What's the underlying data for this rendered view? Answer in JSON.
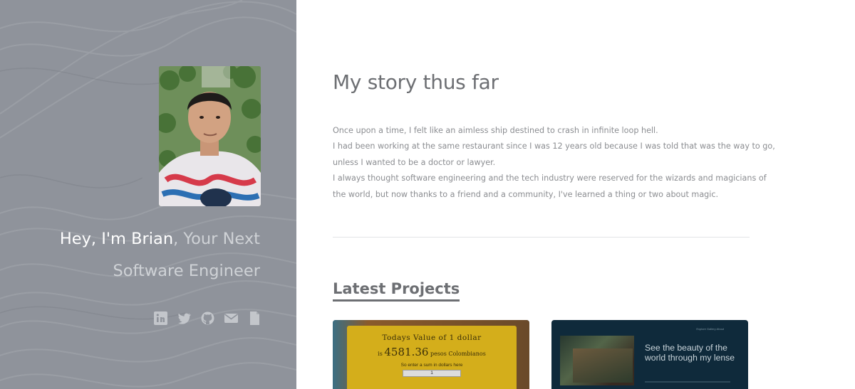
{
  "profile": {
    "greeting": "Hey, I'm Brian",
    "tagline_part1": ", Your Next",
    "tagline_part2": "Software Engineer",
    "photo_alt": "Portrait of Brian"
  },
  "socials": [
    {
      "icon": "linkedin-icon"
    },
    {
      "icon": "twitter-icon"
    },
    {
      "icon": "github-icon"
    },
    {
      "icon": "email-icon"
    },
    {
      "icon": "resume-document-icon"
    }
  ],
  "story": {
    "title": "My story thus far",
    "paragraphs": [
      "Once upon a time, I felt like an aimless ship destined to crash in infinite loop hell.",
      "I had been working at the same restaurant since I was 12 years old because I was told that was the way to go,",
      "unless I wanted to be a doctor or lawyer.",
      "I always thought software engineering and the tech industry were reserved for the wizards and magicians of",
      "the world, but now thanks to a friend and a community, I've learned a thing or two about magic."
    ]
  },
  "projects": {
    "heading": "Latest Projects",
    "cards": [
      {
        "title": "Todays Value of 1 dollar",
        "value_prefix": "is",
        "value": "4581.36",
        "value_suffix": "pesos Colombianos",
        "hint": "So enter a sum in dollars here",
        "input_value": "1"
      },
      {
        "nav_text": "Explore  Gallery  About",
        "headline": "See the beauty of the world through my lense"
      }
    ]
  },
  "colors": {
    "left_panel": "#8f939b",
    "heading": "#6d6f73",
    "body_text": "#8b8d91",
    "card1_box": "#d4ae1b",
    "card2_bg": "#0f2a3b"
  }
}
